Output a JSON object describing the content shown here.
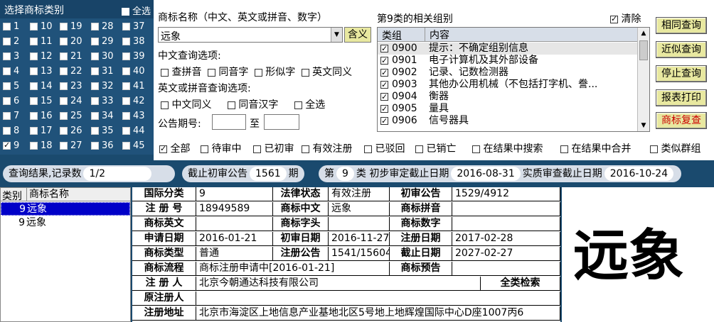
{
  "category_panel": {
    "title": "选择商标类别",
    "select_all": "全选",
    "columns": [
      [
        "1",
        "2",
        "3",
        "4",
        "5",
        "6",
        "7",
        "8",
        "9"
      ],
      [
        "10",
        "11",
        "12",
        "13",
        "14",
        "15",
        "16",
        "17",
        "18"
      ],
      [
        "19",
        "20",
        "21",
        "22",
        "23",
        "24",
        "25",
        "26",
        "27"
      ],
      [
        "28",
        "29",
        "30",
        "31",
        "32",
        "33",
        "34",
        "35",
        "36"
      ],
      [
        "37",
        "38",
        "39",
        "40",
        "41",
        "42",
        "43",
        "44",
        "45"
      ]
    ],
    "checked": [
      "9"
    ]
  },
  "query": {
    "name_label": "商标名称（中文、英文或拼音、数字）",
    "name_value": "远象",
    "meaning_button": "含义",
    "cn_options_label": "中文查询选项:",
    "cn_options": [
      "查拼音",
      "同音字",
      "形似字",
      "英文同义"
    ],
    "en_options_label": "英文或拼音查询选项:",
    "en_options": [
      "中文同义",
      "同音汉字",
      "全选"
    ],
    "pub_label": "公告期号:",
    "to_label": "至",
    "pub_from": "",
    "pub_to": ""
  },
  "groups": {
    "title": "第9类的相关组别",
    "clear": "清除",
    "col_group": "类组",
    "col_content": "内容",
    "rows": [
      {
        "code": "0900",
        "text": "提示：不确定组别信息"
      },
      {
        "code": "0901",
        "text": "电子计算机及其外部设备"
      },
      {
        "code": "0902",
        "text": "记录、记数检测器"
      },
      {
        "code": "0903",
        "text": "其他办公用机械（不包括打字机、誊..."
      },
      {
        "code": "0904",
        "text": "衡器"
      },
      {
        "code": "0905",
        "text": "量具"
      },
      {
        "code": "0906",
        "text": "信号器具"
      }
    ]
  },
  "buttons": [
    "相同查询",
    "近似查询",
    "停止查询",
    "报表打印",
    "商标复查"
  ],
  "filters": [
    "全部",
    "待审中",
    "已初审",
    "有效注册",
    "已驳回",
    "已销亡",
    "在结果中搜索",
    "在结果中合并",
    "类似群组"
  ],
  "status": {
    "results_label": "查询结果,记录数",
    "results_value": "1/2",
    "deadline_label": "截止初审公告",
    "deadline_value": "1561",
    "deadline_unit": "期",
    "issue_prefix": "第",
    "issue_value": "9",
    "issue_unit": "类",
    "init_label": "初步审定截止日期",
    "init_value": "2016-08-31",
    "substantive_label": "实质审查截止日期",
    "substantive_value": "2016-10-24"
  },
  "result_list": {
    "col_class": "类别",
    "col_name": "商标名称",
    "rows": [
      {
        "cls": "9",
        "name": "远象"
      },
      {
        "cls": "9",
        "name": "远象"
      }
    ]
  },
  "detail": {
    "intl_class_label": "国际分类",
    "intl_class": "9",
    "legal_label": "法律状态",
    "legal": "有效注册",
    "init_pub_label": "初审公告",
    "init_pub": "1529/4912",
    "reg_no_label": "注 册 号",
    "reg_no": "18949589",
    "cn_label": "商标中文",
    "cn": "远象",
    "pinyin_label": "商标拼音",
    "pinyin": "",
    "en_label": "商标英文",
    "en": "",
    "head_label": "商标字头",
    "head": "",
    "digit_label": "商标数字",
    "digit": "",
    "apply_label": "申请日期",
    "apply": "2016-01-21",
    "init_date_label": "初审日期",
    "init_date": "2016-11-27",
    "reg_date_label": "注册日期",
    "reg_date": "2017-02-28",
    "type_label": "商标类型",
    "type": "普通",
    "reg_pub_label": "注册公告",
    "reg_pub": "1541/15604",
    "expire_label": "截止日期",
    "expire": "2027-02-27",
    "flow_label": "商标流程",
    "flow": "商标注册申请中[2016-01-21]",
    "warn_label": "商标预告",
    "warn": "",
    "registrant_label": "注 册 人",
    "registrant": "北京今朝通达科技有限公司",
    "all_class_btn": "全类检索",
    "orig_label": "原注册人",
    "orig": "",
    "addr_label": "注册地址",
    "addr": "北京市海淀区上地信息产业基地北区5号地上地辉煌国际中心D座1007丙6"
  },
  "image_text": "远象"
}
